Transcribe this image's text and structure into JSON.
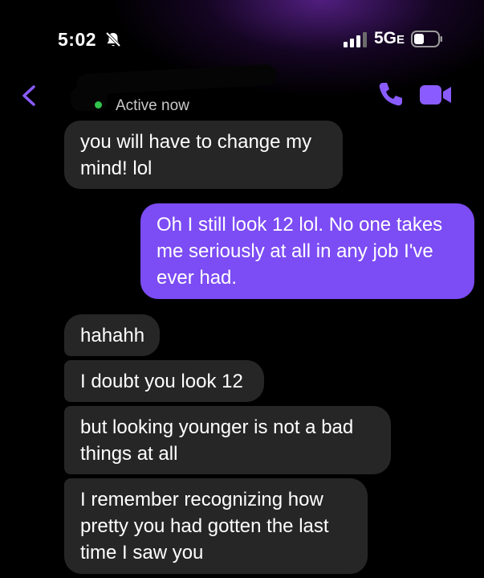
{
  "status_bar": {
    "time": "5:02",
    "network": "5G",
    "network_suffix": "E"
  },
  "header": {
    "presence": "Active now"
  },
  "colors": {
    "sent_bubble": "#7c4cf4",
    "received_bubble": "#262626",
    "accent": "#8a5cff",
    "active_dot": "#30c54c"
  },
  "icons": {
    "back": "chevron-left-icon",
    "call": "phone-icon",
    "video": "video-camera-icon",
    "mute": "bell-slash-icon"
  },
  "messages": [
    {
      "direction": "received",
      "lines": [
        "you will have to change my",
        "mind! lol"
      ]
    },
    {
      "direction": "sent",
      "lines": [
        "Oh I still look 12 lol. No one takes",
        "me seriously at all in any job I've",
        "ever had."
      ]
    },
    {
      "direction": "received",
      "lines": [
        "hahahh"
      ]
    },
    {
      "direction": "received",
      "lines": [
        "I doubt you look 12"
      ]
    },
    {
      "direction": "received",
      "lines": [
        "but looking younger is not a bad",
        "things at all"
      ]
    },
    {
      "direction": "received",
      "lines": [
        "I remember recognizing how",
        "pretty you had gotten the last",
        "time I saw you"
      ]
    }
  ]
}
